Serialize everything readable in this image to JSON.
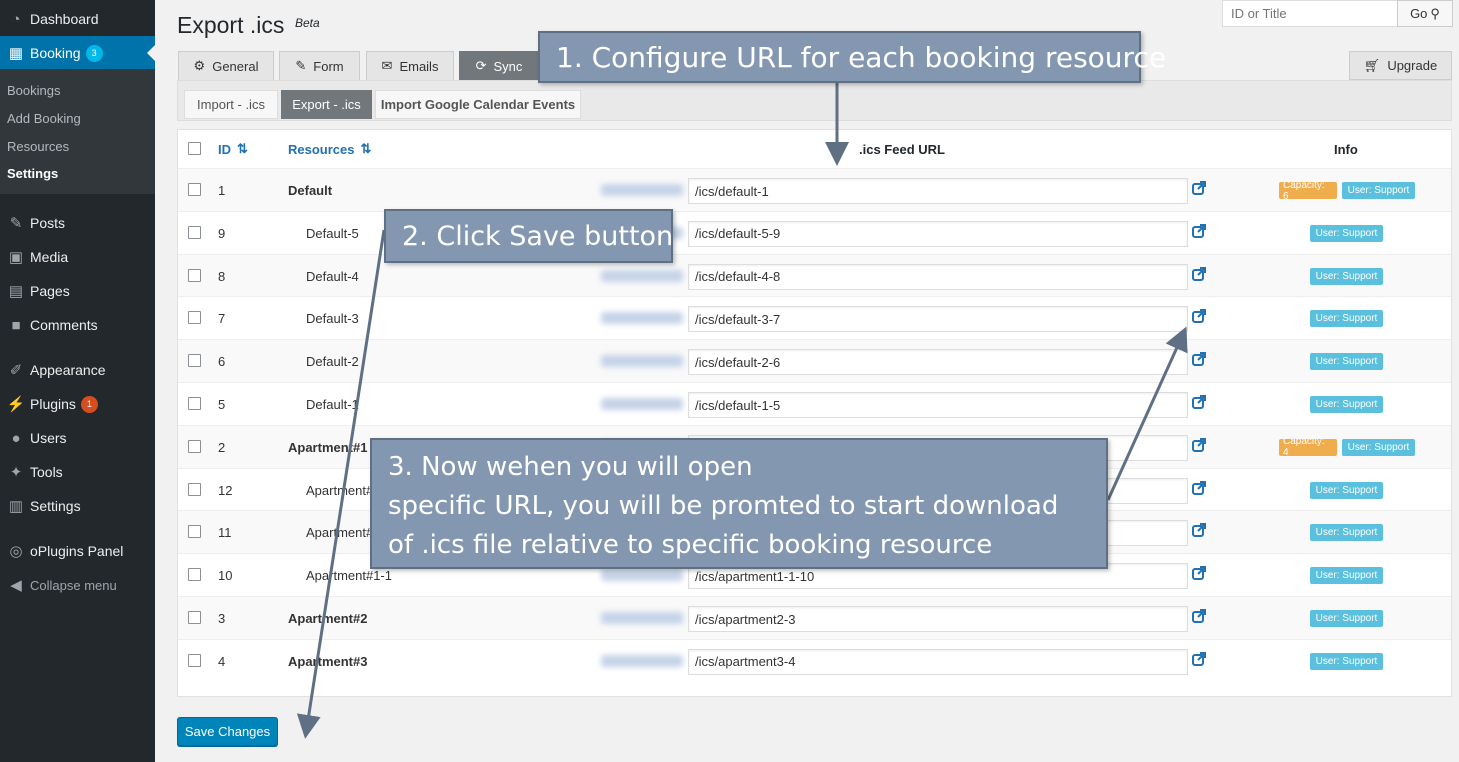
{
  "sidebar": {
    "items": [
      {
        "label": "Dashboard",
        "icon": "dashboard-icon"
      },
      {
        "label": "Booking",
        "icon": "calendar-icon",
        "badge": "3"
      },
      {
        "label": "Posts",
        "icon": "pin-icon"
      },
      {
        "label": "Media",
        "icon": "media-icon"
      },
      {
        "label": "Pages",
        "icon": "pages-icon"
      },
      {
        "label": "Comments",
        "icon": "comment-icon"
      },
      {
        "label": "Appearance",
        "icon": "brush-icon"
      },
      {
        "label": "Plugins",
        "icon": "plugin-icon",
        "badge": "1"
      },
      {
        "label": "Users",
        "icon": "user-icon"
      },
      {
        "label": "Tools",
        "icon": "wrench-icon"
      },
      {
        "label": "Settings",
        "icon": "settings-icon"
      },
      {
        "label": "oPlugins Panel",
        "icon": "circle-icon"
      },
      {
        "label": "Collapse menu",
        "icon": "collapse-icon"
      }
    ],
    "submenu": [
      "Bookings",
      "Add Booking",
      "Resources",
      "Settings"
    ]
  },
  "header": {
    "title": "Export .ics",
    "beta": "Beta",
    "search_placeholder": "ID or Title",
    "go_label": "Go"
  },
  "tabs": [
    "General",
    "Form",
    "Emails",
    "Sync"
  ],
  "upgrade_label": "Upgrade",
  "subtabs": [
    "Import - .ics",
    "Export - .ics",
    "Import Google Calendar Events"
  ],
  "table": {
    "headers": {
      "id": "ID",
      "resources": "Resources",
      "feed": ".ics Feed URL",
      "info": "Info"
    },
    "rows": [
      {
        "id": "1",
        "name": "Default",
        "url": "/ics/default-1",
        "capacity": "Capacity: 6",
        "user": "User: Support"
      },
      {
        "id": "9",
        "name": "Default-5",
        "url": "/ics/default-5-9",
        "user": "User: Support"
      },
      {
        "id": "8",
        "name": "Default-4",
        "url": "/ics/default-4-8",
        "user": "User: Support"
      },
      {
        "id": "7",
        "name": "Default-3",
        "url": "/ics/default-3-7",
        "user": "User: Support"
      },
      {
        "id": "6",
        "name": "Default-2",
        "url": "/ics/default-2-6",
        "user": "User: Support"
      },
      {
        "id": "5",
        "name": "Default-1",
        "url": "/ics/default-1-5",
        "user": "User: Support"
      },
      {
        "id": "2",
        "name": "Apartment#1",
        "url": "",
        "capacity": "Capacity: 4",
        "user": "User: Support"
      },
      {
        "id": "12",
        "name": "Apartment#",
        "url": "",
        "user": "User: Support"
      },
      {
        "id": "11",
        "name": "Apartment#",
        "url": "",
        "user": "User: Support"
      },
      {
        "id": "10",
        "name": "Apartment#1-1",
        "url": "/ics/apartment1-1-10",
        "user": "User: Support"
      },
      {
        "id": "3",
        "name": "Apartment#2",
        "url": "/ics/apartment2-3",
        "user": "User: Support"
      },
      {
        "id": "4",
        "name": "Apartment#3",
        "url": "/ics/apartment3-4",
        "user": "User: Support"
      }
    ]
  },
  "save_label": "Save Changes",
  "callouts": {
    "c1": "1. Configure URL for each booking resource",
    "c2": "2. Click Save button",
    "c3_lines": [
      "3. Now wehen  you will  open",
      "specific URL,  you will  be promted to  start download",
      "of .ics file relative to  specific booking resource"
    ]
  },
  "colors": {
    "sidebar_bg": "#23282d",
    "accent": "#0073aa",
    "callout_bg": "#8497b0",
    "capacity": "#f0ad4e",
    "user_label": "#5bc0de"
  }
}
